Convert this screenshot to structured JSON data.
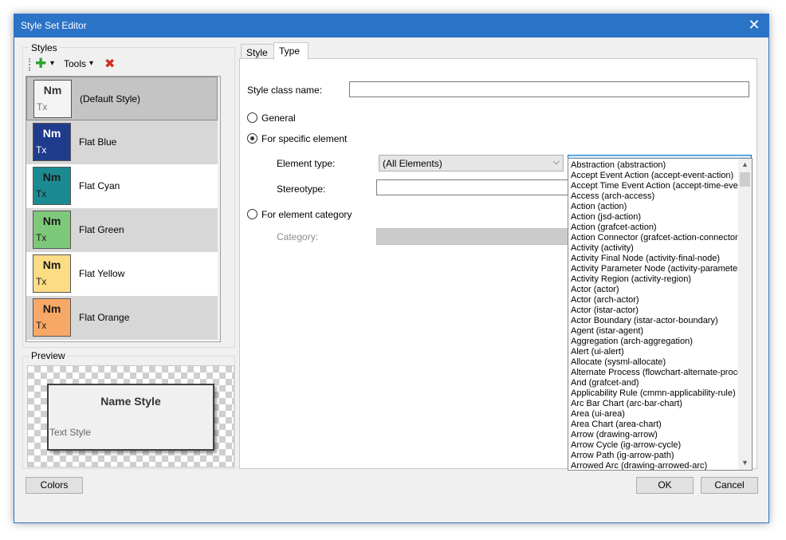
{
  "window": {
    "title": "Style Set Editor",
    "close_glyph": "✕"
  },
  "styles_panel": {
    "label": "Styles",
    "toolbar": {
      "add_glyph": "✚",
      "dropdown_glyph": "▾",
      "tools_label": "Tools",
      "delete_glyph": "✖"
    },
    "items": [
      {
        "label": "(Default Style)",
        "nm": "Nm",
        "tx": "Tx",
        "fill": "#f4f4f4",
        "text_color": "#333333"
      },
      {
        "label": "Flat Blue",
        "nm": "Nm",
        "tx": "Tx",
        "fill": "#1f3b8c",
        "text_color": "#ffffff"
      },
      {
        "label": "Flat Cyan",
        "nm": "Nm",
        "tx": "Tx",
        "fill": "#1c8a91",
        "text_color": "#1a1a1a"
      },
      {
        "label": "Flat Green",
        "nm": "Nm",
        "tx": "Tx",
        "fill": "#7ec87a",
        "text_color": "#1a1a1a"
      },
      {
        "label": "Flat Yellow",
        "nm": "Nm",
        "tx": "Tx",
        "fill": "#fcdc84",
        "text_color": "#1a1a1a"
      },
      {
        "label": "Flat Orange",
        "nm": "Nm",
        "tx": "Tx",
        "fill": "#f8a866",
        "text_color": "#1a1a1a"
      }
    ],
    "partial_item_fill": "#e06060"
  },
  "preview": {
    "label": "Preview",
    "name_text": "Name Style",
    "text_text": "Text Style"
  },
  "tabs": [
    {
      "label": "Style"
    },
    {
      "label": "Type"
    }
  ],
  "type_tab": {
    "style_class_name_label": "Style class name:",
    "style_class_name_value": "",
    "radio_general": "General",
    "radio_specific": "For specific element",
    "element_type_label": "Element type:",
    "element_type_value": "(All Elements)",
    "element_subtype_value": "",
    "stereotype_label": "Stereotype:",
    "radio_category": "For element category",
    "category_label": "Category:"
  },
  "dropdown_items": [
    "Abstraction (abstraction)",
    "Accept Event Action (accept-event-action)",
    "Accept Time Event Action (accept-time-event-action)",
    "Access (arch-access)",
    "Action (action)",
    "Action (jsd-action)",
    "Action (grafcet-action)",
    "Action Connector (grafcet-action-connector)",
    "Activity (activity)",
    "Activity Final Node (activity-final-node)",
    "Activity Parameter Node (activity-parameter-node)",
    "Activity Region (activity-region)",
    "Actor (actor)",
    "Actor (arch-actor)",
    "Actor (istar-actor)",
    "Actor Boundary (istar-actor-boundary)",
    "Agent (istar-agent)",
    "Aggregation (arch-aggregation)",
    "Alert (ui-alert)",
    "Allocate (sysml-allocate)",
    "Alternate Process (flowchart-alternate-process)",
    "And (grafcet-and)",
    "Applicability Rule (cmmn-applicability-rule)",
    "Arc Bar Chart (arc-bar-chart)",
    "Area (ui-area)",
    "Area Chart (area-chart)",
    "Arrow (drawing-arrow)",
    "Arrow Cycle (ig-arrow-cycle)",
    "Arrow Path (ig-arrow-path)",
    "Arrowed Arc (drawing-arrowed-arc)"
  ],
  "buttons": {
    "colors": "Colors",
    "ok": "OK",
    "cancel": "Cancel"
  }
}
